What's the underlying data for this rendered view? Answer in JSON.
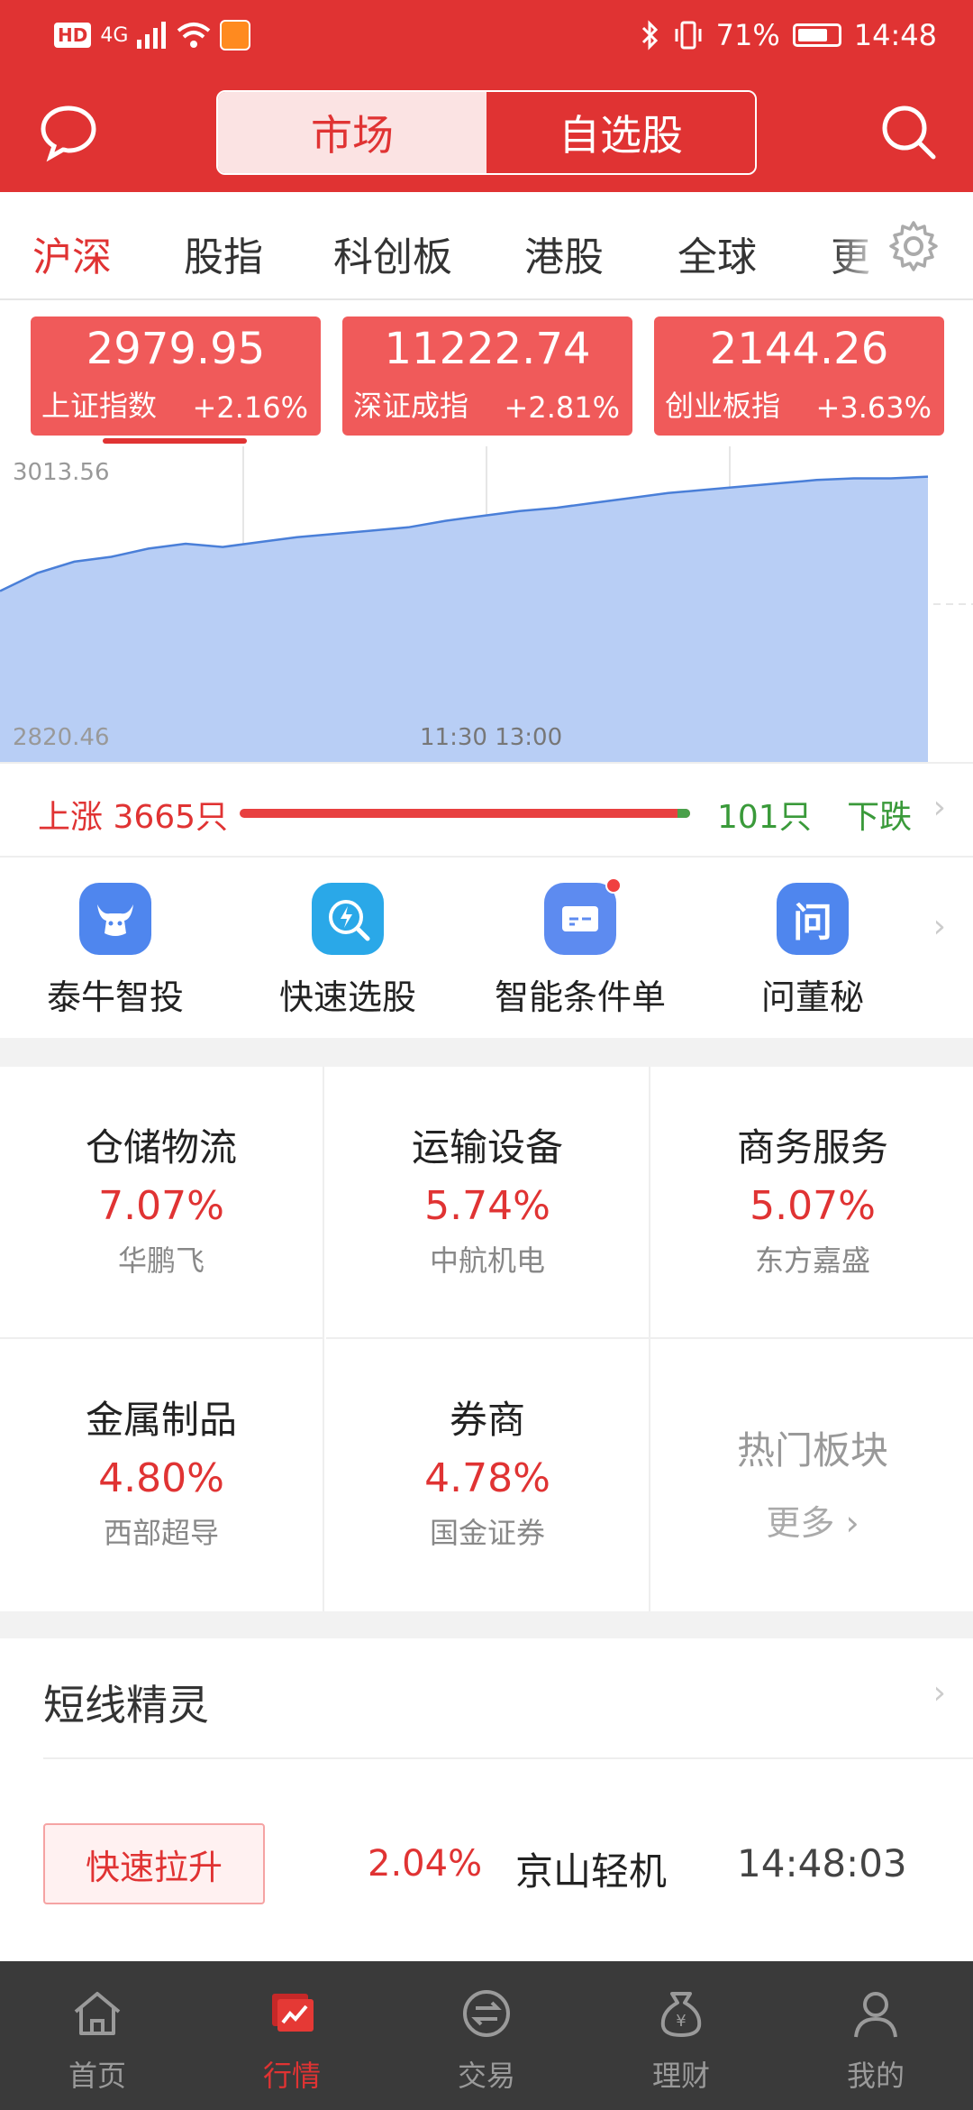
{
  "status": {
    "network": "4G",
    "battery": "71%",
    "time": "14:48"
  },
  "header": {
    "segment": [
      "市场",
      "自选股"
    ]
  },
  "tabs": [
    "沪深",
    "股指",
    "科创板",
    "港股",
    "全球",
    "更"
  ],
  "indices": [
    {
      "value": "2979.95",
      "name": "上证指数",
      "change": "+2.16%"
    },
    {
      "value": "11222.74",
      "name": "深证成指",
      "change": "+2.81%"
    },
    {
      "value": "2144.26",
      "name": "创业板指",
      "change": "+3.63%"
    }
  ],
  "chart_data": {
    "type": "area",
    "title": "",
    "ylim": [
      2820.46,
      3013.56
    ],
    "y_labels": [
      "3013.56",
      "2820.46"
    ],
    "x_labels": [
      "11:30 13:00"
    ],
    "series": [
      {
        "values": [
          2925,
          2936,
          2943,
          2946,
          2951,
          2954,
          2952,
          2955,
          2958,
          2960,
          2962,
          2964,
          2968,
          2971,
          2974,
          2976,
          2979,
          2982,
          2985,
          2987,
          2989,
          2991,
          2993,
          2994,
          2994,
          2995
        ]
      }
    ],
    "colors": {
      "fill": "#b8cef5",
      "line": "#4a7fd8"
    }
  },
  "advance": {
    "up": "上涨 3665只",
    "down_count": "101只",
    "down_label": "下跌"
  },
  "tools": [
    {
      "label": "泰牛智投",
      "icon": "bull-icon"
    },
    {
      "label": "快速选股",
      "icon": "search-lightning-icon"
    },
    {
      "label": "智能条件单",
      "icon": "card-icon"
    },
    {
      "label": "问董秘",
      "icon": "ask-icon",
      "glyph": "问"
    }
  ],
  "sectors": [
    {
      "name": "仓储物流",
      "pct": "7.07%",
      "stock": "华鹏飞"
    },
    {
      "name": "运输设备",
      "pct": "5.74%",
      "stock": "中航机电"
    },
    {
      "name": "商务服务",
      "pct": "5.07%",
      "stock": "东方嘉盛"
    },
    {
      "name": "金属制品",
      "pct": "4.80%",
      "stock": "西部超导"
    },
    {
      "name": "券商",
      "pct": "4.78%",
      "stock": "国金证券"
    }
  ],
  "hot": {
    "title": "热门板块",
    "more": "更多"
  },
  "shortline": {
    "title": "短线精灵",
    "rows": [
      {
        "tag": "快速拉升",
        "pct": "2.04%",
        "name": "京山轻机",
        "time": "14:48:03"
      }
    ]
  },
  "bottom_nav": [
    "首页",
    "行情",
    "交易",
    "理财",
    "我的"
  ],
  "colors": {
    "primary": "#e03333",
    "card": "#f05a5a",
    "down": "#3a9a3a"
  }
}
